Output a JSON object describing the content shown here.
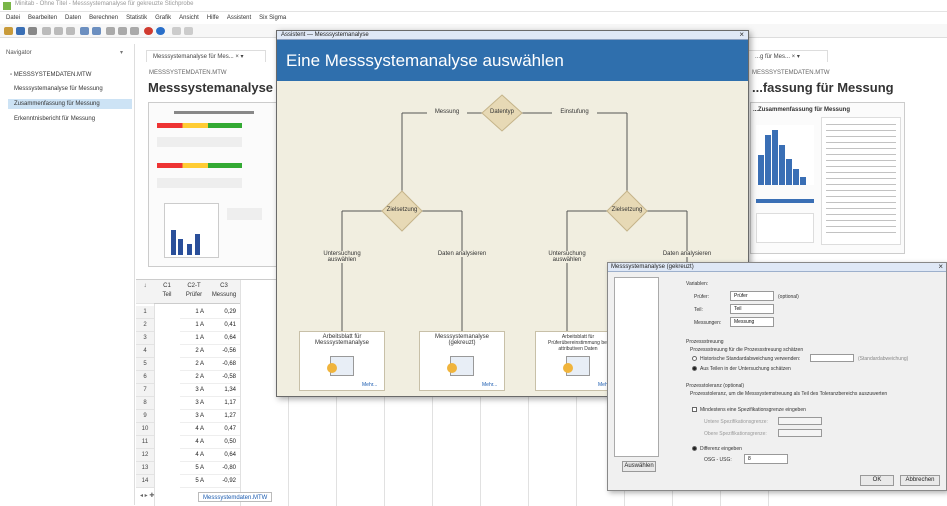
{
  "window": {
    "title": "Minitab - Ohne Titel - Messsystemanalyse für gekreuzte Stichprobe"
  },
  "menu": [
    "Datei",
    "Bearbeiten",
    "Daten",
    "Berechnen",
    "Statistik",
    "Grafik",
    "Ansicht",
    "Hilfe",
    "Assistent",
    "Six Sigma"
  ],
  "navigator": {
    "header": "Navigator",
    "items": [
      "MESSSYSTEMDATEN.MTW",
      "Messsystemanalyse für Messung",
      "Zusammenfassung für Messung",
      "Erkenntnisbericht für Messung"
    ],
    "selected_index": 2
  },
  "tabs": [
    {
      "label": "Messsystemanalyse für Mes...  × ▾"
    },
    {
      "label": "...g für Mes...  × ▾"
    }
  ],
  "output_left": {
    "small": "MESSSYSTEMDATEN.MTW",
    "title": "Messsystemanalyse für M"
  },
  "output_right": {
    "small": "MESSSYSTEMDATEN.MTW",
    "title": "...fassung für Messung",
    "report_title": "...Zusammenfassung für Messung"
  },
  "worksheet": {
    "columns": [
      {
        "id": "C1",
        "name": "Teil"
      },
      {
        "id": "C2-T",
        "name": "Prüfer"
      },
      {
        "id": "C3",
        "name": "Messung"
      }
    ],
    "rows": [
      [
        "1",
        "1 A",
        "0,29"
      ],
      [
        "2",
        "1 A",
        "0,41"
      ],
      [
        "3",
        "1 A",
        "0,64"
      ],
      [
        "4",
        "2 A",
        "-0,56"
      ],
      [
        "5",
        "2 A",
        "-0,68"
      ],
      [
        "6",
        "2 A",
        "-0,58"
      ],
      [
        "7",
        "3 A",
        "1,34"
      ],
      [
        "8",
        "3 A",
        "1,17"
      ],
      [
        "9",
        "3 A",
        "1,27"
      ],
      [
        "10",
        "4 A",
        "0,47"
      ],
      [
        "11",
        "4 A",
        "0,50"
      ],
      [
        "12",
        "4 A",
        "0,64"
      ],
      [
        "13",
        "5 A",
        "-0,80"
      ],
      [
        "14",
        "5 A",
        "-0,92"
      ]
    ],
    "sheet_tab": "Messsystemdaten.MTW"
  },
  "assistant": {
    "window_title": "Assistent — Messsystemanalyse",
    "close": "×",
    "heading": "Eine Messsystemanalyse auswählen",
    "top_decision": "Datentyp",
    "left_branch": "Messung",
    "right_branch": "Einstufung",
    "left_decision": "Zielsetzung",
    "right_decision": "Zielsetzung",
    "left_left": "Untersuchung auswählen",
    "left_right": "Daten analysieren",
    "right_left": "Untersuchung auswählen",
    "right_right": "Daten analysieren",
    "card1": "Arbeitsblatt für Messsystemanalyse",
    "card2": "Messsystemanalyse (gekreuzt)",
    "card3": "Arbeitsblatt für Prüferübereinstimmung bei attributiven Daten",
    "more": "Mehr..."
  },
  "dialog": {
    "title": "Messsystemanalyse (gekreuzt)",
    "close": "×",
    "section_vars": "Variablen:",
    "part_label": "Prüfer:",
    "part_value": "Prüfer",
    "part_opt": "(optional)",
    "teil_label": "Teil:",
    "teil_value": "Teil",
    "mess_label": "Messungen:",
    "mess_value": "Messung",
    "var_section": "Prozessstreuung",
    "var_desc": "Prozessstreuung für die Prozessstreuung schätzen",
    "opt1": "Historische Standardabweichung verwenden:",
    "opt2": "Aus Teilen in der Untersuchung schätzen",
    "opt1_note": "(Standardabweichung)",
    "tol_section": "Prozesstoleranz (optional)",
    "tol_desc": "Prozesstoleranz, um die Messsystemstreuung als Teil des Toleranzbereichs auszuwerten",
    "tol_check": "Mindestens eine Spezifikationsgrenze eingeben",
    "lsl": "Untere Spezifikationsgrenze:",
    "usl": "Obere Spezifikationsgrenze:",
    "diff_check": "Differenz eingeben",
    "diff_label": "OSG - USG:",
    "diff_value": "8",
    "select_btn": "Auswählen",
    "ok_btn": "OK",
    "cancel_btn": "Abbrechen"
  }
}
